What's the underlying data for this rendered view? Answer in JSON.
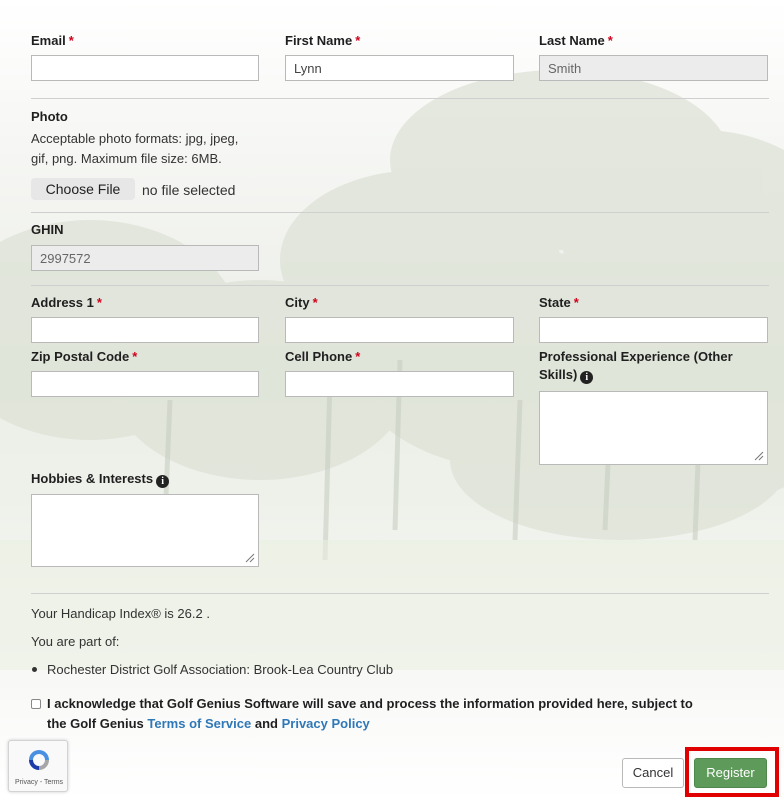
{
  "fields": {
    "email": {
      "label": "Email",
      "required_mark": "*",
      "value": ""
    },
    "first_name": {
      "label": "First Name",
      "required_mark": "*",
      "value": "Lynn"
    },
    "last_name": {
      "label": "Last Name",
      "required_mark": "*",
      "value": "Smith"
    },
    "photo": {
      "label": "Photo",
      "help_line1": "Acceptable photo formats: jpg, jpeg,",
      "help_line2": "gif, png. Maximum file size: 6MB.",
      "button": "Choose File",
      "status": "no file selected"
    },
    "ghin": {
      "label": "GHIN",
      "value": "2997572"
    },
    "address1": {
      "label": "Address 1",
      "required_mark": "*",
      "value": ""
    },
    "city": {
      "label": "City",
      "required_mark": "*",
      "value": ""
    },
    "state": {
      "label": "State",
      "required_mark": "*",
      "value": ""
    },
    "zip": {
      "label": "Zip Postal Code",
      "required_mark": "*",
      "value": ""
    },
    "cell_phone": {
      "label": "Cell Phone",
      "required_mark": "*",
      "value": ""
    },
    "professional_experience": {
      "label_line1": "Professional Experience (Other",
      "label_line2": "Skills)",
      "info_icon": "i"
    },
    "hobbies": {
      "label": "Hobbies & Interests",
      "info_icon": "i"
    }
  },
  "handicap": {
    "text": "Your Handicap Index® is 26.2 .",
    "part_of_label": "You are part of:",
    "memberships": [
      "Rochester District Golf Association: Brook-Lea Country Club"
    ]
  },
  "acknowledge": {
    "text_line1": "I acknowledge that Golf Genius Software will save and process the information provided here, subject to",
    "text_prefix": "the Golf Genius",
    "terms_link": "Terms of Service",
    "and": "and",
    "privacy_link": "Privacy Policy"
  },
  "recaptcha": {
    "text": "Privacy - Terms"
  },
  "actions": {
    "cancel": "Cancel",
    "register": "Register"
  },
  "colors": {
    "required": "#d0021b",
    "link": "#2f78b8",
    "register_bg": "#5e9a5a",
    "highlight_box": "#e00000"
  },
  "icons": {
    "info": "info-circle-icon",
    "resize": "textarea-resize-grip-icon",
    "recaptcha": "recaptcha-logo-icon",
    "checkbox": "checkbox-icon"
  }
}
